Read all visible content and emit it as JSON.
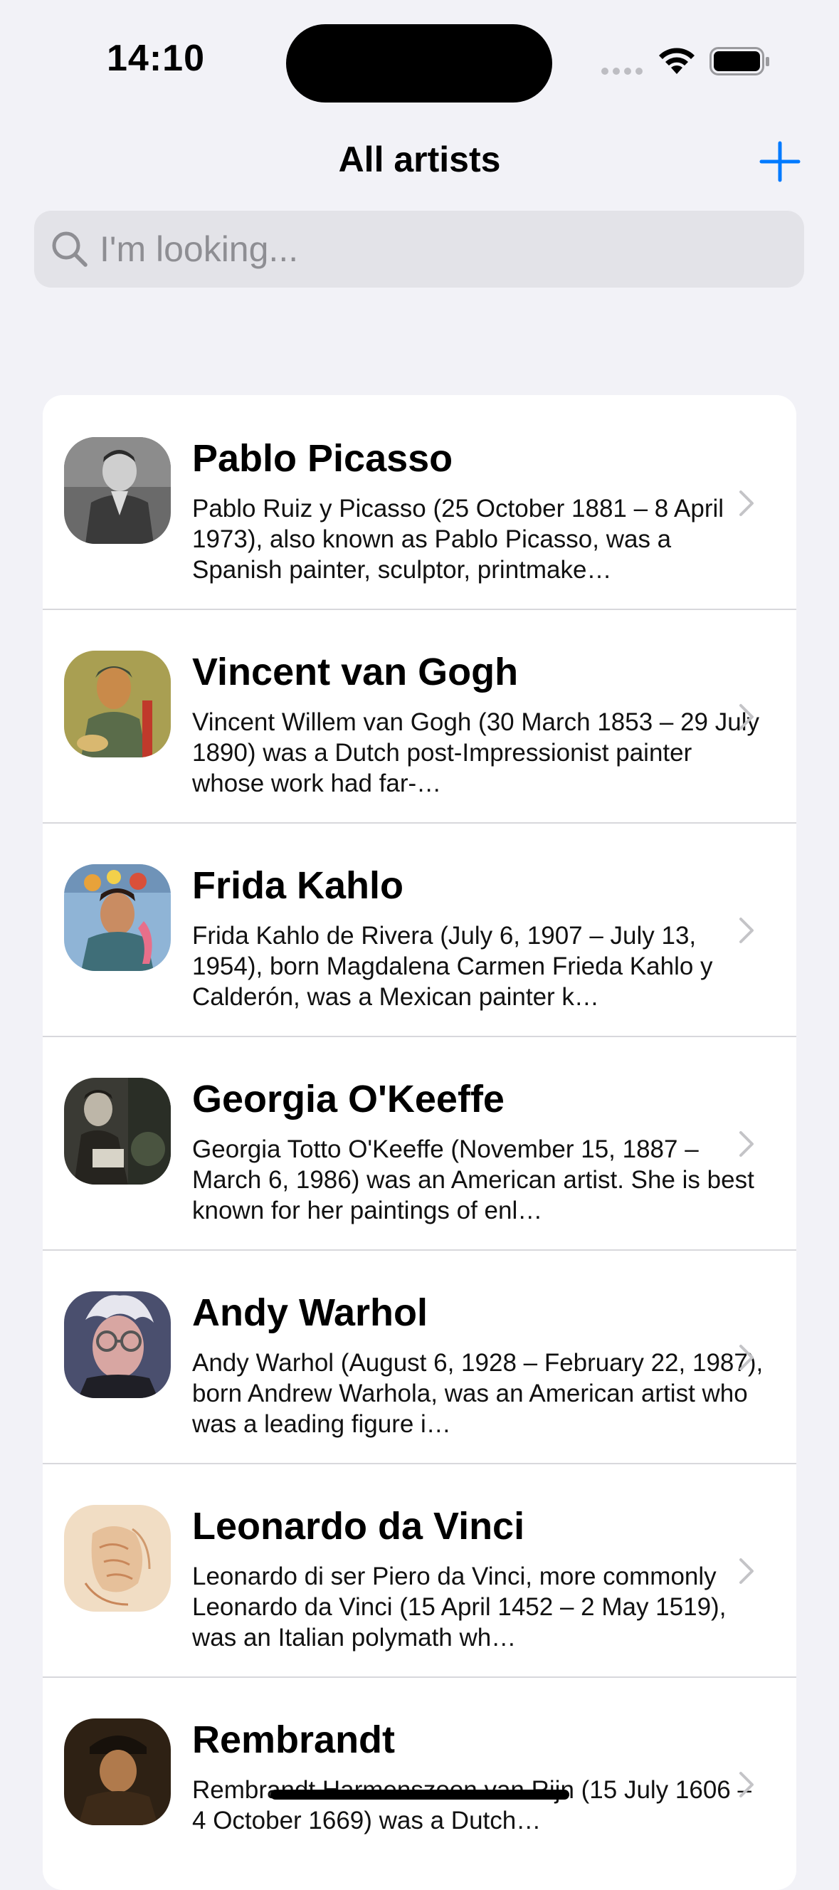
{
  "status_bar": {
    "time": "14:10"
  },
  "nav": {
    "title": "All artists"
  },
  "search": {
    "placeholder": "I'm looking..."
  },
  "artists": [
    {
      "name": "Pablo Picasso",
      "description": "Pablo Ruiz y Picasso (25 October 1881 – 8 April 1973), also known as Pablo Picasso, was a Spanish painter, sculptor, printmake…"
    },
    {
      "name": "Vincent van Gogh",
      "description": "Vincent Willem van Gogh (30 March 1853 – 29 July 1890) was a Dutch post-Impressionist painter whose work had far-…"
    },
    {
      "name": "Frida Kahlo",
      "description": "Frida Kahlo de Rivera (July 6, 1907 – July 13, 1954), born Magdalena Carmen Frieda Kahlo y Calderón, was a Mexican painter k…"
    },
    {
      "name": "Georgia O'Keeffe",
      "description": "Georgia Totto O'Keeffe (November 15, 1887 – March 6, 1986) was an American artist. She is best known for her paintings of enl…"
    },
    {
      "name": "Andy Warhol",
      "description": "Andy Warhol (August 6, 1928 – February 22, 1987), born Andrew Warhola, was an American artist who was a leading figure i…"
    },
    {
      "name": "Leonardo da Vinci",
      "description": "Leonardo di ser Piero da Vinci, more commonly Leonardo da Vinci (15 April 1452 – 2 May 1519), was an Italian polymath wh…"
    },
    {
      "name": "Rembrandt",
      "description": "Rembrandt Harmenszoon van Rijn (15 July 1606 – 4 October 1669) was a Dutch…"
    }
  ],
  "colors": {
    "accent": "#007AFF",
    "background": "#F2F2F7",
    "chevron": "#C4C4C7"
  }
}
